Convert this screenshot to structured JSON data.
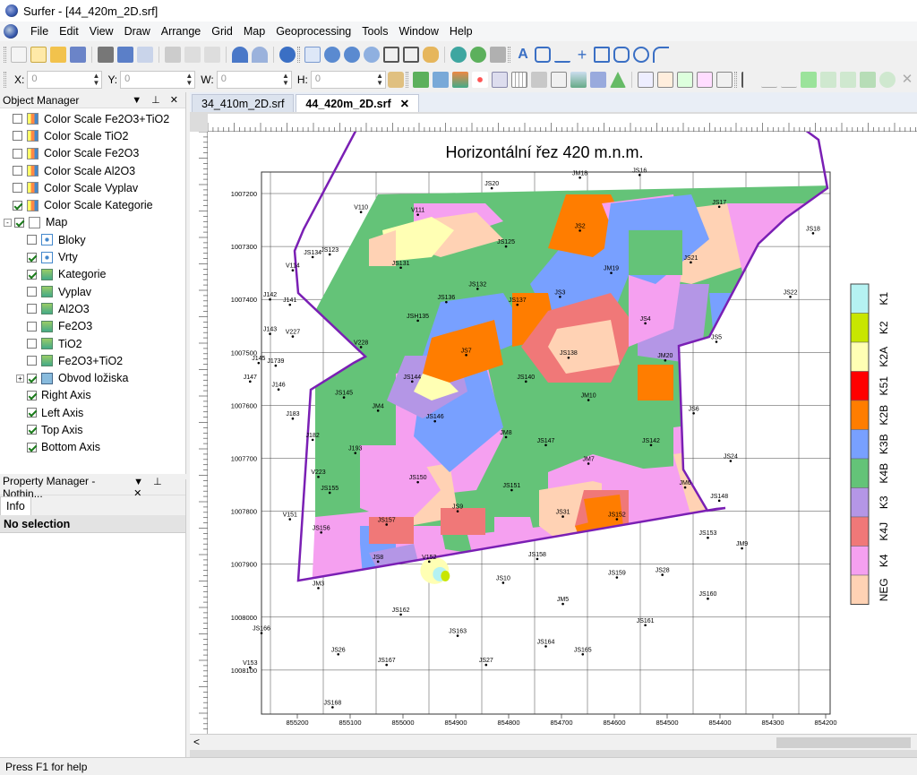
{
  "window": {
    "title": "Surfer - [44_420m_2D.srf]"
  },
  "menu": [
    "File",
    "Edit",
    "View",
    "Draw",
    "Arrange",
    "Grid",
    "Map",
    "Geoprocessing",
    "Tools",
    "Window",
    "Help"
  ],
  "coords": {
    "x_label": "X:",
    "x_value": "0",
    "y_label": "Y:",
    "y_value": "0",
    "w_label": "W:",
    "w_value": "0",
    "h_label": "H:",
    "h_value": "0"
  },
  "object_manager": {
    "title": "Object Manager",
    "items": [
      {
        "label": "Color Scale Fe2O3+TiO2",
        "checked": false,
        "indent": 1,
        "icon": "color-scale-icon"
      },
      {
        "label": "Color Scale TiO2",
        "checked": false,
        "indent": 1,
        "icon": "color-scale-icon"
      },
      {
        "label": "Color Scale Fe2O3",
        "checked": false,
        "indent": 1,
        "icon": "color-scale-icon"
      },
      {
        "label": "Color Scale Al2O3",
        "checked": false,
        "indent": 1,
        "icon": "color-scale-icon"
      },
      {
        "label": "Color Scale Vyplav",
        "checked": false,
        "indent": 1,
        "icon": "color-scale-icon"
      },
      {
        "label": "Color Scale Kategorie",
        "checked": true,
        "indent": 1,
        "icon": "color-scale-icon"
      },
      {
        "label": "Map",
        "checked": true,
        "indent": 0,
        "icon": "map-icon",
        "expander": "-"
      },
      {
        "label": "Bloky",
        "checked": false,
        "indent": 2,
        "icon": "post-layer-icon"
      },
      {
        "label": "Vrty",
        "checked": true,
        "indent": 2,
        "icon": "post-layer-icon"
      },
      {
        "label": "Kategorie",
        "checked": true,
        "indent": 2,
        "icon": "image-layer-icon"
      },
      {
        "label": "Vyplav",
        "checked": false,
        "indent": 2,
        "icon": "image-layer-icon"
      },
      {
        "label": "Al2O3",
        "checked": false,
        "indent": 2,
        "icon": "image-layer-icon"
      },
      {
        "label": "Fe2O3",
        "checked": false,
        "indent": 2,
        "icon": "image-layer-icon"
      },
      {
        "label": "TiO2",
        "checked": false,
        "indent": 2,
        "icon": "image-layer-icon"
      },
      {
        "label": "Fe2O3+TiO2",
        "checked": false,
        "indent": 2,
        "icon": "image-layer-icon"
      },
      {
        "label": "Obvod ložiska",
        "checked": true,
        "indent": 2,
        "icon": "base-layer-icon",
        "expander": "+"
      },
      {
        "label": "Right Axis",
        "checked": true,
        "indent": 2,
        "icon": "none"
      },
      {
        "label": "Left Axis",
        "checked": true,
        "indent": 2,
        "icon": "none"
      },
      {
        "label": "Top Axis",
        "checked": true,
        "indent": 2,
        "icon": "none"
      },
      {
        "label": "Bottom Axis",
        "checked": true,
        "indent": 2,
        "icon": "none"
      }
    ]
  },
  "property_manager": {
    "title": "Property Manager - Nothin...",
    "tab": "Info",
    "selection": "No selection"
  },
  "document_tabs": [
    {
      "label": "34_410m_2D.srf",
      "active": false
    },
    {
      "label": "44_420m_2D.srf",
      "active": true
    }
  ],
  "map": {
    "title": "Horizontální řez 420 m.n.m.",
    "x_ticks": [
      "855200",
      "855100",
      "855000",
      "854900",
      "854800",
      "854700",
      "854600",
      "854500",
      "854400",
      "854300",
      "854200"
    ],
    "y_ticks": [
      "1007200",
      "1007300",
      "1007400",
      "1007500",
      "1007600",
      "1007700",
      "1007800",
      "1007900",
      "1008000",
      "1008100"
    ],
    "boreholes": [
      {
        "id": "JM18",
        "x": 854705,
        "y": 1007170
      },
      {
        "id": "JS16",
        "x": 854600,
        "y": 1007165
      },
      {
        "id": "JS20",
        "x": 854860,
        "y": 1007190
      },
      {
        "id": "JS17",
        "x": 854460,
        "y": 1007225
      },
      {
        "id": "JS18",
        "x": 854295,
        "y": 1007275
      },
      {
        "id": "V110",
        "x": 855090,
        "y": 1007235
      },
      {
        "id": "V111",
        "x": 854990,
        "y": 1007240
      },
      {
        "id": "JS2",
        "x": 854705,
        "y": 1007270
      },
      {
        "id": "JS125",
        "x": 854835,
        "y": 1007300
      },
      {
        "id": "JS123",
        "x": 855145,
        "y": 1007315
      },
      {
        "id": "JS134",
        "x": 855175,
        "y": 1007320
      },
      {
        "id": "JS131",
        "x": 855020,
        "y": 1007340
      },
      {
        "id": "V114",
        "x": 855210,
        "y": 1007345
      },
      {
        "id": "JM19",
        "x": 854650,
        "y": 1007350
      },
      {
        "id": "JS21",
        "x": 854510,
        "y": 1007330
      },
      {
        "id": "JS132",
        "x": 854885,
        "y": 1007380
      },
      {
        "id": "JS22",
        "x": 854335,
        "y": 1007395
      },
      {
        "id": "J142",
        "x": 855250,
        "y": 1007400
      },
      {
        "id": "JS3",
        "x": 854740,
        "y": 1007395
      },
      {
        "id": "JS136",
        "x": 854940,
        "y": 1007405
      },
      {
        "id": "JS137",
        "x": 854815,
        "y": 1007410
      },
      {
        "id": "J141",
        "x": 855215,
        "y": 1007410
      },
      {
        "id": "JSH135",
        "x": 854990,
        "y": 1007440
      },
      {
        "id": "JS4",
        "x": 854590,
        "y": 1007445
      },
      {
        "id": "J143",
        "x": 855250,
        "y": 1007465
      },
      {
        "id": "V227",
        "x": 855210,
        "y": 1007470
      },
      {
        "id": "JS5",
        "x": 854465,
        "y": 1007480
      },
      {
        "id": "V228",
        "x": 855090,
        "y": 1007490
      },
      {
        "id": "JS7",
        "x": 854905,
        "y": 1007505
      },
      {
        "id": "JS138",
        "x": 854725,
        "y": 1007510
      },
      {
        "id": "J145",
        "x": 855270,
        "y": 1007520
      },
      {
        "id": "J1739",
        "x": 855240,
        "y": 1007525
      },
      {
        "id": "JM20",
        "x": 854555,
        "y": 1007515
      },
      {
        "id": "J147",
        "x": 855285,
        "y": 1007555
      },
      {
        "id": "JS144",
        "x": 855000,
        "y": 1007555
      },
      {
        "id": "JS140",
        "x": 854800,
        "y": 1007555
      },
      {
        "id": "J146",
        "x": 855235,
        "y": 1007570
      },
      {
        "id": "JS145",
        "x": 855120,
        "y": 1007585
      },
      {
        "id": "JM10",
        "x": 854690,
        "y": 1007590
      },
      {
        "id": "JM4",
        "x": 855060,
        "y": 1007610
      },
      {
        "id": "JS6",
        "x": 854505,
        "y": 1007615
      },
      {
        "id": "J183",
        "x": 855210,
        "y": 1007625
      },
      {
        "id": "JS146",
        "x": 854960,
        "y": 1007630
      },
      {
        "id": "JM8",
        "x": 854835,
        "y": 1007660
      },
      {
        "id": "J182",
        "x": 855175,
        "y": 1007665
      },
      {
        "id": "JS147",
        "x": 854765,
        "y": 1007675
      },
      {
        "id": "JS142",
        "x": 854580,
        "y": 1007675
      },
      {
        "id": "J193",
        "x": 855100,
        "y": 1007690
      },
      {
        "id": "JM7",
        "x": 854690,
        "y": 1007710
      },
      {
        "id": "JS24",
        "x": 854440,
        "y": 1007705
      },
      {
        "id": "V223",
        "x": 855165,
        "y": 1007735
      },
      {
        "id": "JS150",
        "x": 854990,
        "y": 1007745
      },
      {
        "id": "JM6",
        "x": 854520,
        "y": 1007755
      },
      {
        "id": "JS151",
        "x": 854825,
        "y": 1007760
      },
      {
        "id": "JS155",
        "x": 855145,
        "y": 1007765
      },
      {
        "id": "JS148",
        "x": 854460,
        "y": 1007780
      },
      {
        "id": "JS9",
        "x": 854920,
        "y": 1007800
      },
      {
        "id": "JS31",
        "x": 854735,
        "y": 1007810
      },
      {
        "id": "V151",
        "x": 855215,
        "y": 1007815
      },
      {
        "id": "JS152",
        "x": 854640,
        "y": 1007815
      },
      {
        "id": "JS157",
        "x": 855045,
        "y": 1007825
      },
      {
        "id": "JS156",
        "x": 855160,
        "y": 1007840
      },
      {
        "id": "JS153",
        "x": 854480,
        "y": 1007850
      },
      {
        "id": "JM9",
        "x": 854420,
        "y": 1007870
      },
      {
        "id": "JS8",
        "x": 855060,
        "y": 1007895
      },
      {
        "id": "V152",
        "x": 854970,
        "y": 1007895
      },
      {
        "id": "JS158",
        "x": 854780,
        "y": 1007890
      },
      {
        "id": "JS28",
        "x": 854560,
        "y": 1007920
      },
      {
        "id": "JS159",
        "x": 854640,
        "y": 1007925
      },
      {
        "id": "JM3",
        "x": 855165,
        "y": 1007945
      },
      {
        "id": "JS10",
        "x": 854840,
        "y": 1007935
      },
      {
        "id": "JS160",
        "x": 854480,
        "y": 1007965
      },
      {
        "id": "JM5",
        "x": 854735,
        "y": 1007975
      },
      {
        "id": "JS162",
        "x": 855020,
        "y": 1007995
      },
      {
        "id": "JS161",
        "x": 854590,
        "y": 1008015
      },
      {
        "id": "JS166",
        "x": 855265,
        "y": 1008030
      },
      {
        "id": "JS163",
        "x": 854920,
        "y": 1008035
      },
      {
        "id": "JS164",
        "x": 854765,
        "y": 1008055
      },
      {
        "id": "JS26",
        "x": 855130,
        "y": 1008070
      },
      {
        "id": "JS165",
        "x": 854700,
        "y": 1008070
      },
      {
        "id": "JS167",
        "x": 855045,
        "y": 1008090
      },
      {
        "id": "JS27",
        "x": 854870,
        "y": 1008090
      },
      {
        "id": "V153",
        "x": 855285,
        "y": 1008095
      },
      {
        "id": "JS168",
        "x": 855140,
        "y": 1008170
      }
    ],
    "legend": [
      {
        "label": "K1",
        "color": "#b5f2f2"
      },
      {
        "label": "K2",
        "color": "#c8e600"
      },
      {
        "label": "K2A",
        "color": "#ffffb4"
      },
      {
        "label": "K51",
        "color": "#ff0000"
      },
      {
        "label": "K2B",
        "color": "#ff7d00"
      },
      {
        "label": "K3B",
        "color": "#78a0ff"
      },
      {
        "label": "K4B",
        "color": "#64c378"
      },
      {
        "label": "K3",
        "color": "#b496e6"
      },
      {
        "label": "K4J",
        "color": "#f07878"
      },
      {
        "label": "K4",
        "color": "#f5a0f0"
      },
      {
        "label": "NEG",
        "color": "#ffd2b4"
      }
    ],
    "boundary_color": "#7a1fb4"
  },
  "status": {
    "text": "Press F1 for help"
  }
}
